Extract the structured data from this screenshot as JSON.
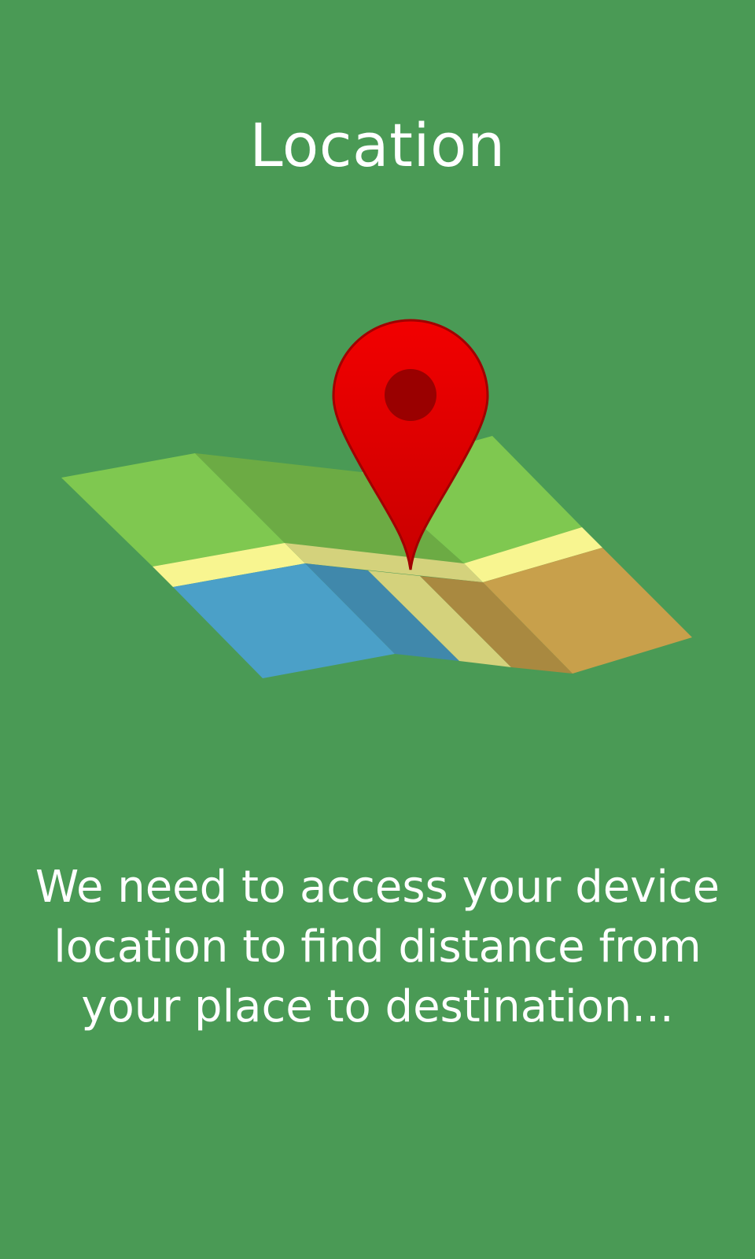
{
  "screen": {
    "title": "Location",
    "message": "We need to access your device location to find distance from your place to destination...",
    "background_color": "#4a9a55"
  },
  "illustration": {
    "icon": "map-with-location-pin",
    "pin_color": "#e00000",
    "colors": {
      "land_light": "#7fc850",
      "land_dark": "#6cab44",
      "road": "#f8f590",
      "road_shadow": "#d4d27c",
      "water": "#4ba0c8",
      "water_dark": "#4088ab",
      "sand": "#c8a04b",
      "sand_dark": "#a98940"
    }
  }
}
